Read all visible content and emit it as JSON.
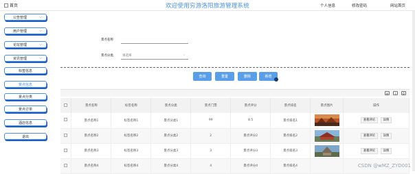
{
  "header": {
    "home": "首页",
    "title": "欢迎使用穷游洛阳旅游管理系统",
    "personal_info": "个人信息",
    "change_password": "修改密码",
    "site_home": "网站首页"
  },
  "sidebar": {
    "items": [
      {
        "label": "公告管理"
      },
      {
        "label": "用户管理"
      },
      {
        "label": "论坛管理"
      },
      {
        "label": "资讯管理"
      },
      {
        "label": "标签信息"
      },
      {
        "label": "景点信息"
      },
      {
        "label": "景点分类"
      },
      {
        "label": "景点订单"
      },
      {
        "label": "酒店信息"
      },
      {
        "label": "退出"
      }
    ]
  },
  "search": {
    "name_label": "景点名称",
    "category_label": "景点分类",
    "category_value": "请选择"
  },
  "buttons": {
    "query": "查询",
    "reset": "重置",
    "delete": "删除",
    "add": "新增"
  },
  "table": {
    "headers": [
      "景点名称",
      "标签名称",
      "景点分类",
      "景点门票",
      "景点评分",
      "景点排名",
      "景点图片",
      "操作"
    ],
    "rows": [
      {
        "name": "景点名称1",
        "tag": "标签名称1",
        "category": "景点分类1",
        "ticket": "99",
        "rating": "8.5",
        "rank": "景点排名1"
      },
      {
        "name": "景点名称2",
        "tag": "标签名称2",
        "category": "景点分类2",
        "ticket": "2",
        "rating": "景点评分2",
        "rank": "景点排名2"
      },
      {
        "name": "景点名称3",
        "tag": "标签名称3",
        "category": "景点分类3",
        "ticket": "3",
        "rating": "景点评分3",
        "rank": "景点排名3"
      },
      {
        "name": "景点名称4",
        "tag": "标签名称4",
        "category": "景点分类4",
        "ticket": "4",
        "rating": "景点评分4",
        "rank": "景点排名4"
      }
    ],
    "action_review": "查看评论",
    "action_detail": "详情"
  },
  "watermark": "CSDN @wMZ_ZYD001",
  "colors": {
    "accent": "#5b9ee8",
    "title": "#4a90e2",
    "sidebar_border": "#4a8fe7",
    "sidebar_shadow": "#1f5fbf"
  }
}
